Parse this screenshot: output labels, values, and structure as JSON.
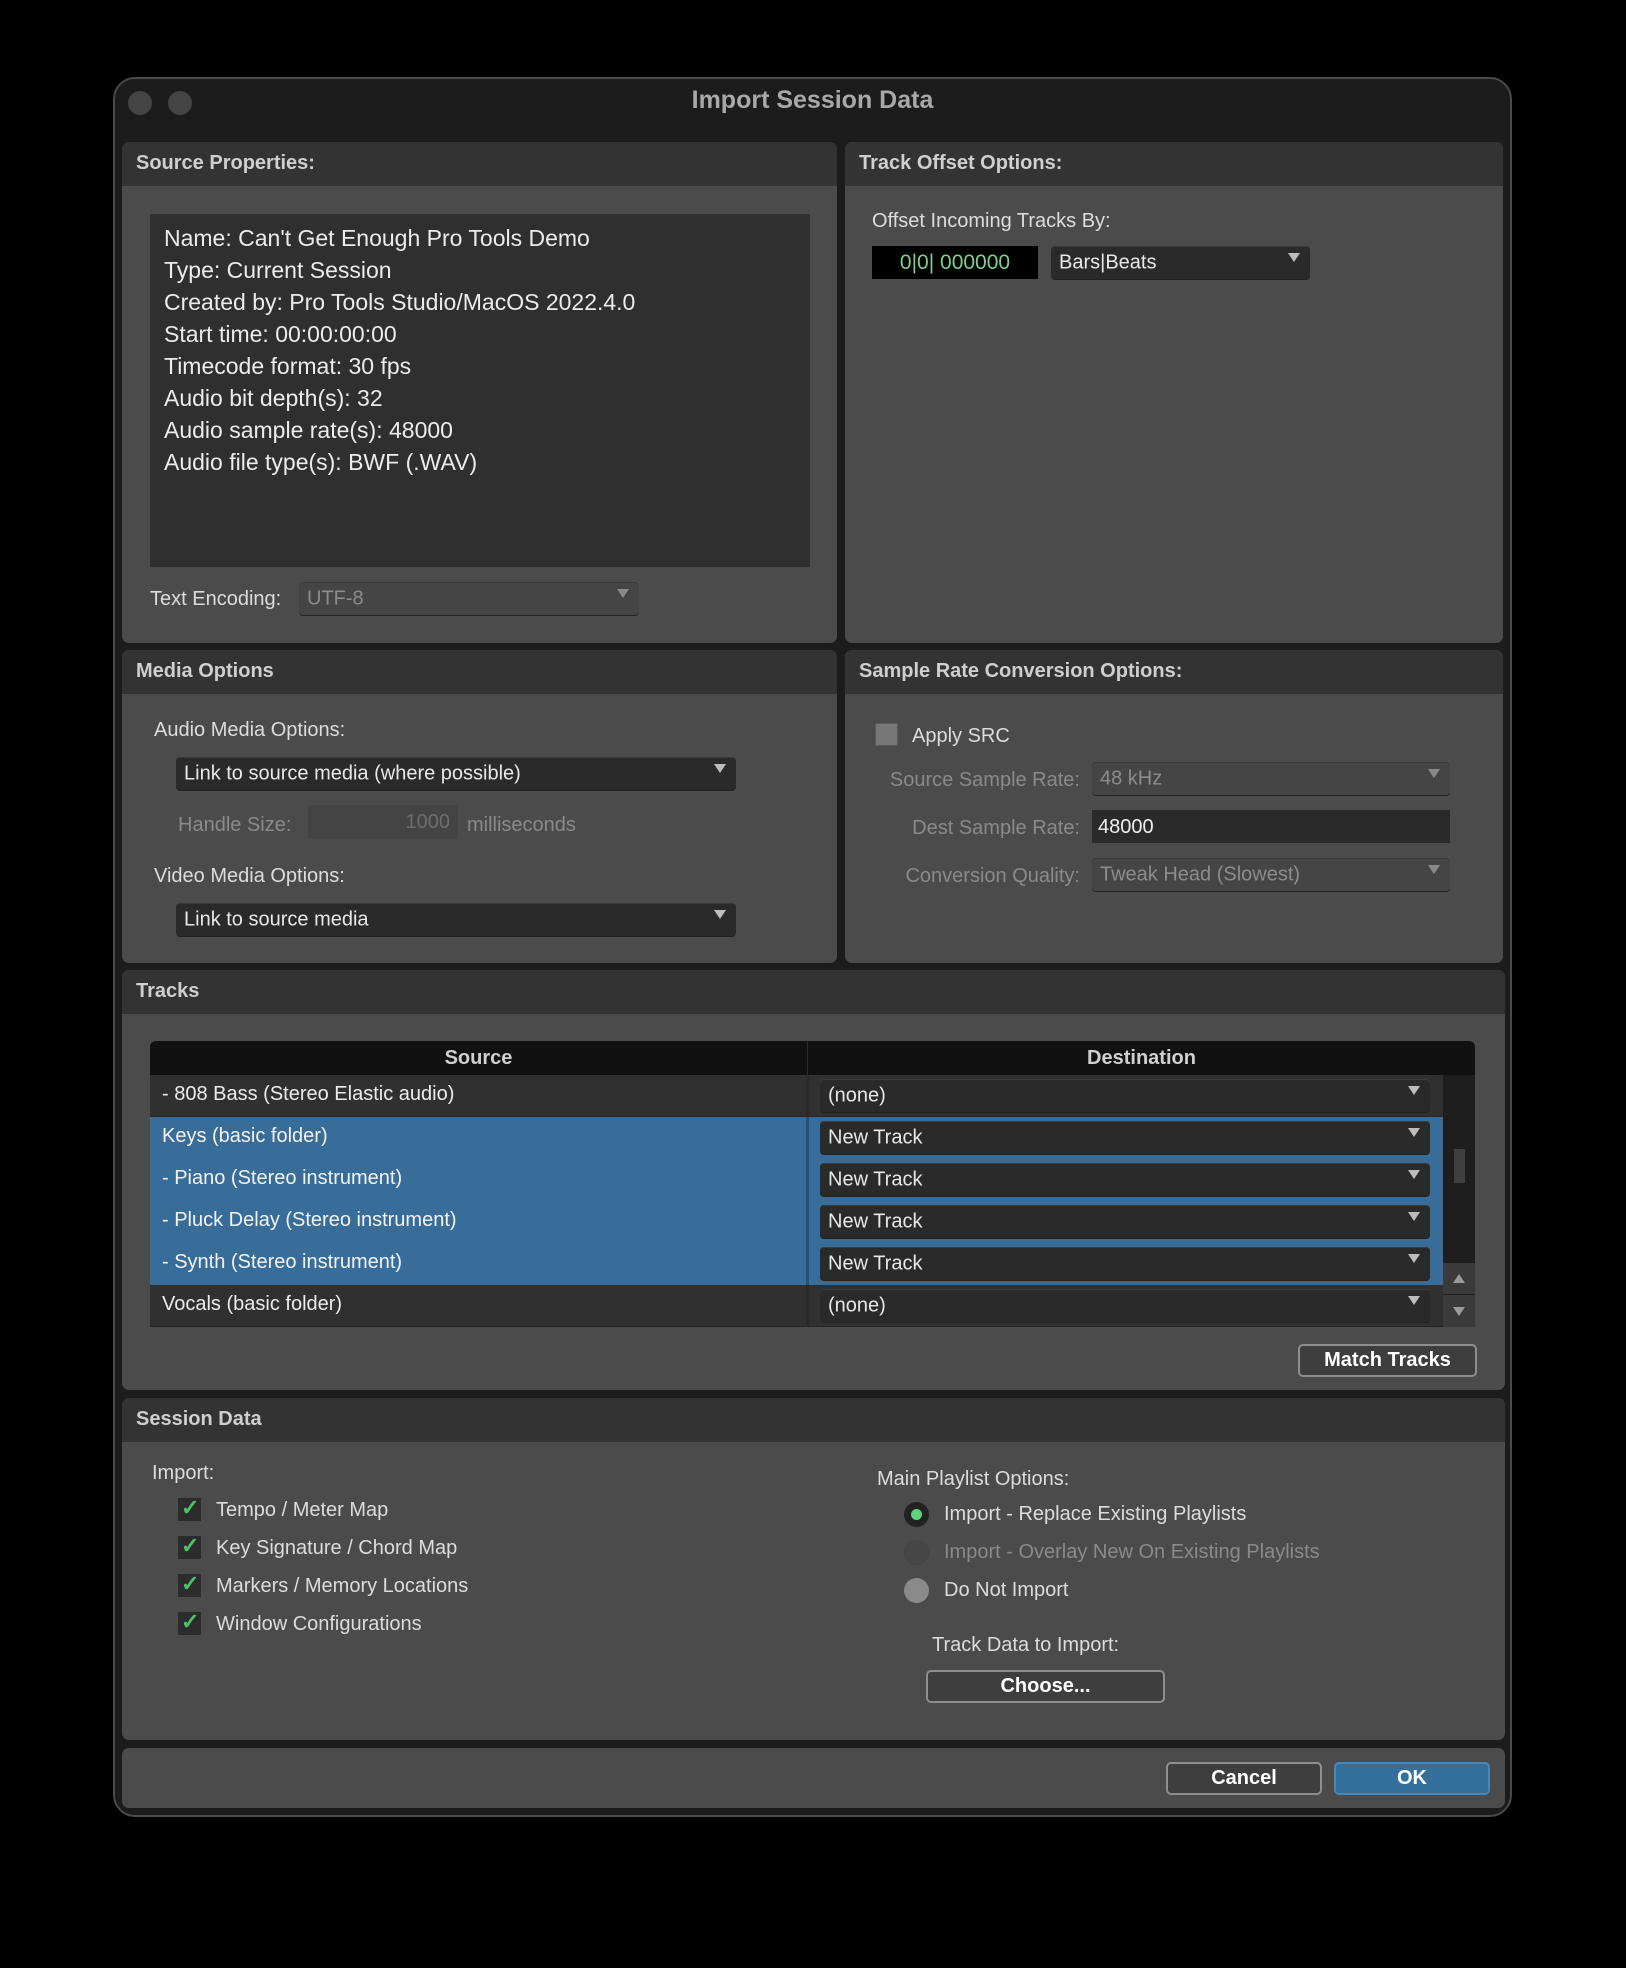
{
  "window": {
    "title": "Import Session Data"
  },
  "source_properties": {
    "title": "Source Properties:",
    "lines": [
      "Name: Can't Get Enough Pro Tools Demo",
      "Type: Current Session",
      "Created by: Pro Tools Studio/MacOS 2022.4.0",
      "Start time: 00:00:00:00",
      "Timecode format: 30 fps",
      "Audio bit depth(s): 32",
      "Audio sample rate(s): 48000",
      "Audio file type(s): BWF (.WAV)"
    ],
    "encoding_label": "Text Encoding:",
    "encoding_value": "UTF-8"
  },
  "track_offset": {
    "title": "Track Offset Options:",
    "label": "Offset Incoming Tracks By:",
    "value": "0|0| 000000",
    "unit": "Bars|Beats"
  },
  "media_options": {
    "title": "Media Options",
    "audio_label": "Audio Media Options:",
    "audio_value": "Link to source media (where possible)",
    "handle_label": "Handle Size:",
    "handle_value": "1000",
    "handle_unit": "milliseconds",
    "video_label": "Video Media Options:",
    "video_value": "Link to source media"
  },
  "src_options": {
    "title": "Sample Rate Conversion Options:",
    "apply_label": "Apply SRC",
    "apply_checked": false,
    "source_rate_label": "Source Sample Rate:",
    "source_rate_value": "48 kHz",
    "dest_rate_label": "Dest Sample Rate:",
    "dest_rate_value": "48000",
    "quality_label": "Conversion Quality:",
    "quality_value": "Tweak Head (Slowest)"
  },
  "tracks": {
    "title": "Tracks",
    "columns": [
      "Source",
      "Destination"
    ],
    "rows": [
      {
        "source": "-  808 Bass (Stereo Elastic audio)",
        "destination": "(none)",
        "selected": false
      },
      {
        "source": "Keys (basic folder)",
        "destination": "New Track",
        "selected": true
      },
      {
        "source": "- Piano (Stereo instrument)",
        "destination": "New Track",
        "selected": true
      },
      {
        "source": "- Pluck Delay (Stereo instrument)",
        "destination": "New Track",
        "selected": true
      },
      {
        "source": "- Synth (Stereo instrument)",
        "destination": "New Track",
        "selected": true
      },
      {
        "source": "Vocals (basic folder)",
        "destination": "(none)",
        "selected": false
      }
    ],
    "match_button": "Match Tracks"
  },
  "session_data": {
    "title": "Session Data",
    "import_label": "Import:",
    "import_items": [
      {
        "label": "Tempo / Meter Map",
        "checked": true
      },
      {
        "label": "Key Signature / Chord Map",
        "checked": true
      },
      {
        "label": "Markers / Memory Locations",
        "checked": true
      },
      {
        "label": "Window Configurations",
        "checked": true
      }
    ],
    "playlist_label": "Main Playlist Options:",
    "playlist_options": [
      {
        "label": "Import - Replace Existing Playlists",
        "state": "selected"
      },
      {
        "label": "Import - Overlay New On Existing Playlists",
        "state": "disabled"
      },
      {
        "label": "Do Not Import",
        "state": "unselected"
      }
    ],
    "track_data_label": "Track Data to Import:",
    "choose_button": "Choose..."
  },
  "footer": {
    "cancel": "Cancel",
    "ok": "OK"
  },
  "icons": {
    "check": "✓",
    "caret": "dropdown-caret"
  },
  "colors": {
    "accent": "#356f9c",
    "selection": "#376d98",
    "check_green": "#4cc36a",
    "timecode_green": "#7fcf8a"
  }
}
